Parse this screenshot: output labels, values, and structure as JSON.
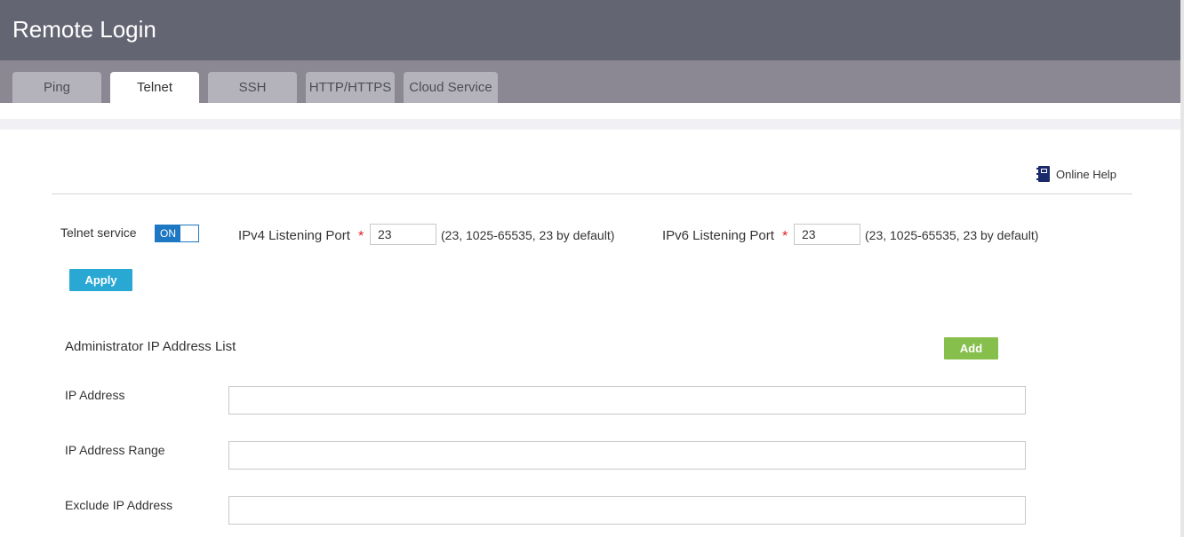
{
  "header": {
    "title": "Remote Login"
  },
  "tabs": [
    {
      "label": "Ping",
      "active": false
    },
    {
      "label": "Telnet",
      "active": true
    },
    {
      "label": "SSH",
      "active": false
    },
    {
      "label": "HTTP/HTTPS",
      "active": false
    },
    {
      "label": "Cloud Service",
      "active": false
    }
  ],
  "help": {
    "label": "Online Help",
    "icon": "book-icon"
  },
  "telnet": {
    "service_label": "Telnet service",
    "toggle_label": "ON",
    "toggle_state": true,
    "ipv4_label": "IPv4 Listening Port",
    "ipv4_value": "23",
    "ipv4_hint": "(23, 1025-65535, 23 by default)",
    "ipv6_label": "IPv6 Listening Port",
    "ipv6_value": "23",
    "ipv6_hint": "(23, 1025-65535, 23 by default)",
    "required_mark": "*",
    "apply_label": "Apply"
  },
  "admin": {
    "title": "Administrator IP Address List",
    "add_label": "Add",
    "ip_label": "IP Address",
    "ip_value": "",
    "range_label": "IP Address Range",
    "range_value": "",
    "exclude_label": "Exclude IP Address",
    "exclude_value": ""
  },
  "colors": {
    "header": "#646573",
    "tabbar": "#8b8893",
    "toggle": "#1e77c2",
    "apply": "#29a8d4",
    "add": "#86bf4b",
    "required": "#e02020"
  }
}
